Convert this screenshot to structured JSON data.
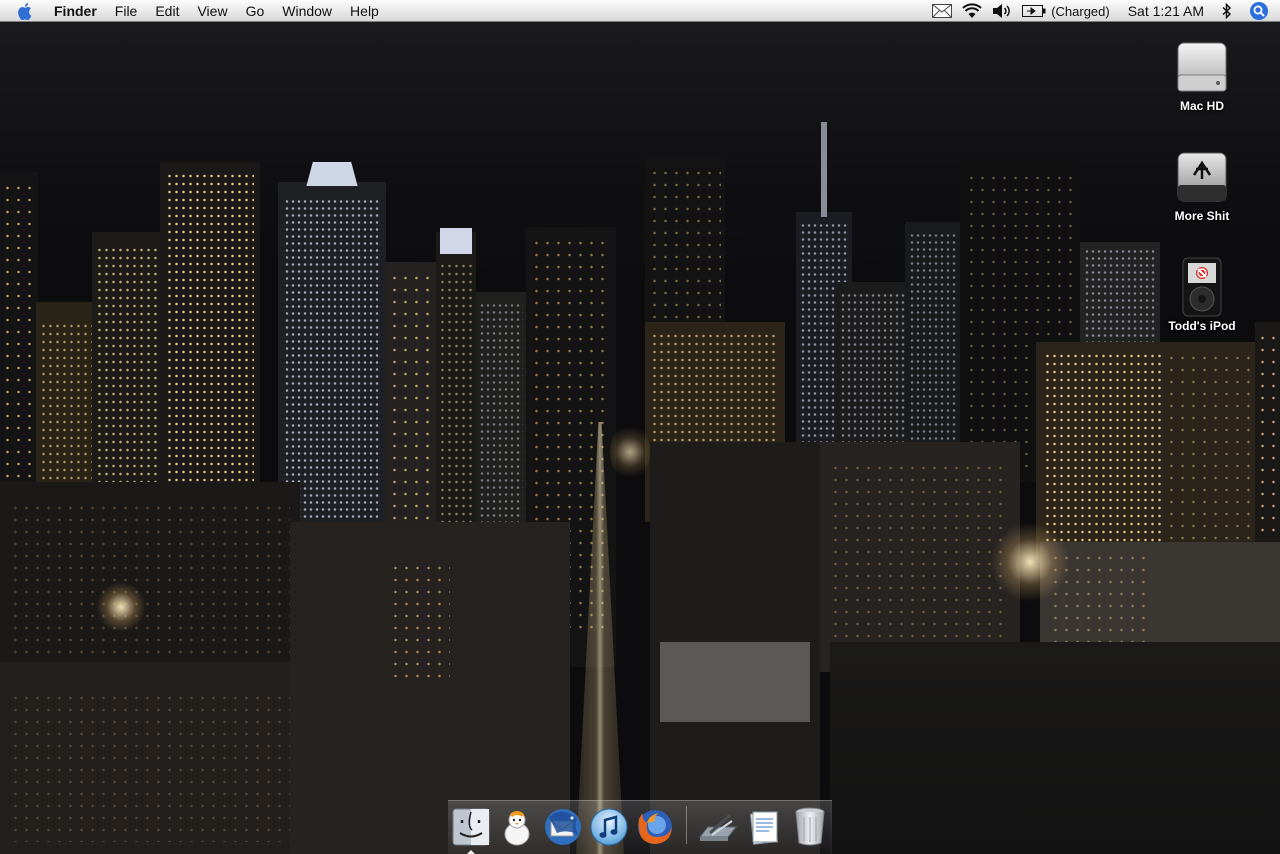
{
  "menubar": {
    "app_name": "Finder",
    "menus": [
      "File",
      "Edit",
      "View",
      "Go",
      "Window",
      "Help"
    ],
    "battery_status": "(Charged)",
    "clock": "Sat 1:21 AM",
    "icons": [
      "apple-icon",
      "mail-icon",
      "wifi-icon",
      "volume-icon",
      "battery-icon",
      "bluetooth-icon",
      "spotlight-icon"
    ]
  },
  "desktop": {
    "icons": [
      {
        "label": "Mac HD",
        "icon": "hard-drive-icon"
      },
      {
        "label": "More Shit",
        "icon": "firewire-drive-icon"
      },
      {
        "label": "Todd's iPod",
        "icon": "ipod-icon"
      }
    ]
  },
  "dock": {
    "items": [
      {
        "name": "finder-icon",
        "running": true
      },
      {
        "name": "adium-icon",
        "running": false
      },
      {
        "name": "thunderbird-icon",
        "running": false
      },
      {
        "name": "itunes-icon",
        "running": false
      },
      {
        "name": "firefox-icon",
        "running": false
      },
      {
        "name": "applications-folder-icon",
        "running": false
      },
      {
        "name": "documents-stack-icon",
        "running": false
      },
      {
        "name": "trash-icon",
        "running": false
      }
    ]
  },
  "colors": {
    "menubar_bg": "#e9e9e9",
    "desktop_bg": "#0b0b0d",
    "window_light": "#ffd68c",
    "spotlight_blue": "#2a6fdc"
  }
}
